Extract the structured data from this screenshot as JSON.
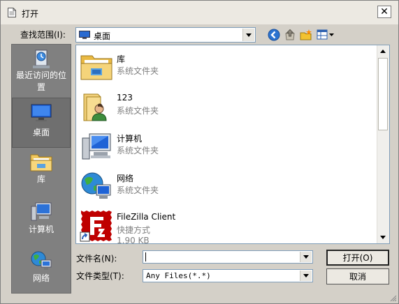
{
  "window": {
    "title": "打开",
    "close_symbol": "✕"
  },
  "lookin": {
    "label": "查找范围(I):",
    "value": "桌面"
  },
  "places": [
    {
      "label": "最近访问的位置",
      "icon": "recent-places-icon"
    },
    {
      "label": "桌面",
      "icon": "desktop-icon",
      "selected": true
    },
    {
      "label": "库",
      "icon": "library-icon"
    },
    {
      "label": "计算机",
      "icon": "computer-icon"
    },
    {
      "label": "网络",
      "icon": "network-icon"
    }
  ],
  "files": [
    {
      "name": "库",
      "type": "系统文件夹",
      "icon": "library-folder-icon"
    },
    {
      "name": "123",
      "type": "系统文件夹",
      "icon": "user-folder-icon"
    },
    {
      "name": "计算机",
      "type": "系统文件夹",
      "icon": "computer-icon"
    },
    {
      "name": "网络",
      "type": "系统文件夹",
      "icon": "network-icon"
    },
    {
      "name": "FileZilla Client",
      "type": "快捷方式",
      "size": "1.90 KB",
      "icon": "filezilla-shortcut-icon"
    }
  ],
  "filename": {
    "label": "文件名(N):",
    "value": ""
  },
  "filetype": {
    "label": "文件类型(T):",
    "value": "Any Files(*.*)"
  },
  "buttons": {
    "open": "打开(O)",
    "cancel": "取消"
  },
  "colors": {
    "places_bg": "#808080",
    "dialog_bg": "#d4d0c8",
    "filezilla_red": "#bf0000"
  }
}
